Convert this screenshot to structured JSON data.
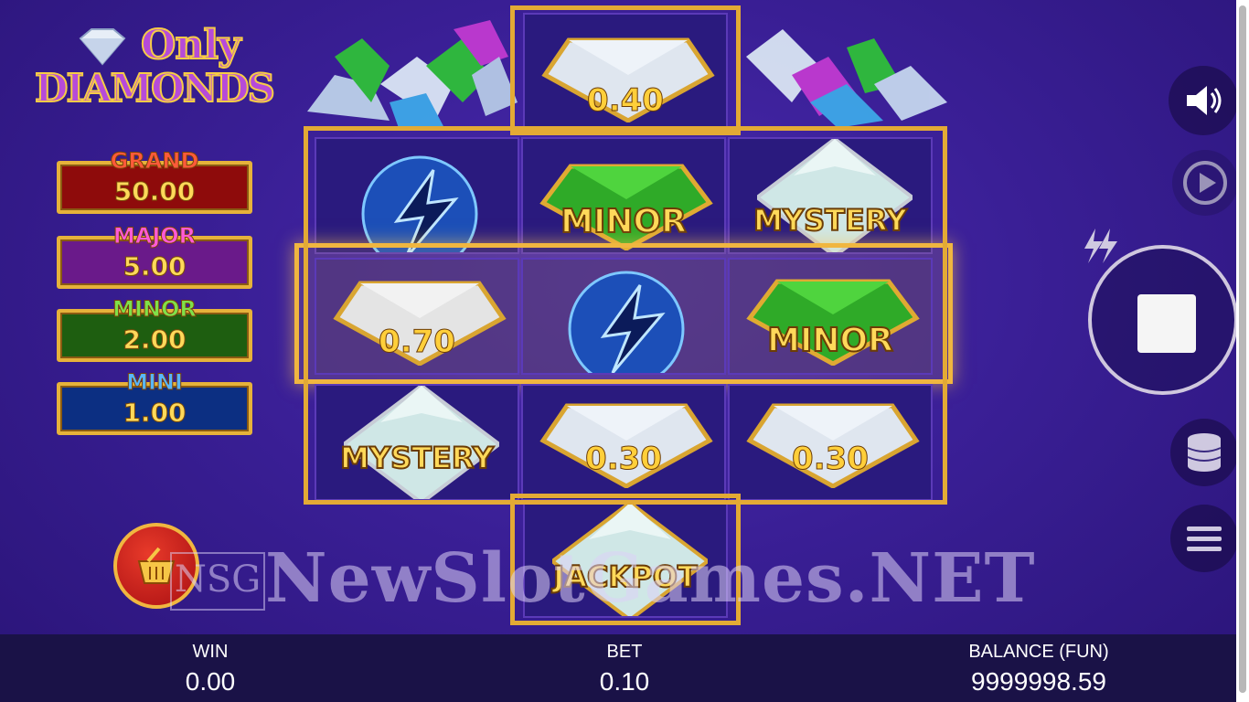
{
  "logo": {
    "line1": "Only",
    "line2": "DIAMONDS"
  },
  "jackpots": [
    {
      "label": "GRAND",
      "value": "50.00",
      "label_color": "#ff5a3a",
      "bg": "#8e0b0b"
    },
    {
      "label": "MAJOR",
      "value": "5.00",
      "label_color": "#ff5ad8",
      "bg": "#6a1a8a"
    },
    {
      "label": "MINOR",
      "value": "2.00",
      "label_color": "#7fe04a",
      "bg": "#1e5e10"
    },
    {
      "label": "MINI",
      "value": "1.00",
      "label_color": "#58b6ff",
      "bg": "#0c2f82"
    }
  ],
  "reels": {
    "top": {
      "type": "diamond",
      "text": "0.40"
    },
    "row1": [
      {
        "type": "lightning",
        "text": ""
      },
      {
        "type": "emerald",
        "text": "MINOR"
      },
      {
        "type": "mystery",
        "text": "MYSTERY"
      }
    ],
    "row2": [
      {
        "type": "diamond",
        "text": "0.70"
      },
      {
        "type": "lightning",
        "text": ""
      },
      {
        "type": "emerald",
        "text": "MINOR"
      }
    ],
    "row3": [
      {
        "type": "mystery",
        "text": "MYSTERY"
      },
      {
        "type": "diamond",
        "text": "0.30"
      },
      {
        "type": "diamond",
        "text": "0.30"
      }
    ],
    "bottom": {
      "type": "jackpot",
      "text": "JACKPOT"
    }
  },
  "watermark": {
    "text": "NewSlotGames.NET",
    "badge": "NSG"
  },
  "controls": {
    "sound_icon": "speaker-icon",
    "autoplay_icon": "autoplay-icon",
    "turbo_icon": "lightning-icon",
    "spin_state": "stop",
    "bet_icon": "coins-stack-icon",
    "menu_icon": "hamburger-icon",
    "shop_icon": "basket-icon"
  },
  "bottom_bar": {
    "win_label": "WIN",
    "win_value": "0.00",
    "bet_label": "BET",
    "bet_value": "0.10",
    "balance_label": "BALANCE (FUN)",
    "balance_value": "9999998.59"
  },
  "colors": {
    "gold": "#e3aa35",
    "reel_bg": "#2a1a7e",
    "bar_bg": "#1a1247"
  }
}
